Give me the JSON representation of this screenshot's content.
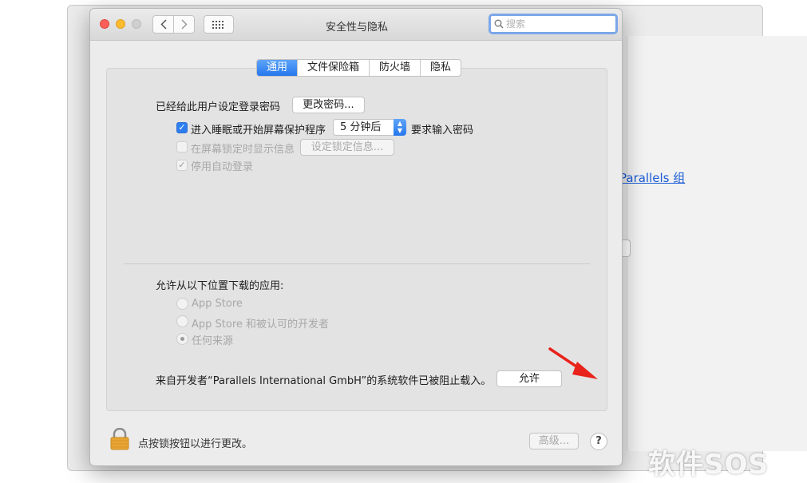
{
  "background_window": {
    "link_text": "Parallels 组"
  },
  "window": {
    "title": "安全性与隐私",
    "search_placeholder": "搜索"
  },
  "tabs": [
    {
      "label": "通用",
      "active": true
    },
    {
      "label": "文件保险箱",
      "active": false
    },
    {
      "label": "防火墙",
      "active": false
    },
    {
      "label": "隐私",
      "active": false
    }
  ],
  "general": {
    "password_set_label": "已经给此用户设定登录密码",
    "change_password_button": "更改密码...",
    "require_password": {
      "checked": true,
      "label": "进入睡眠或开始屏幕保护程序",
      "delay_value": "5 分钟后",
      "suffix": "要求输入密码"
    },
    "show_message": {
      "checked": false,
      "enabled": false,
      "label": "在屏幕锁定时显示信息",
      "button": "设定锁定信息..."
    },
    "disable_auto_login": {
      "checked": true,
      "enabled": false,
      "label": "停用自动登录"
    }
  },
  "downloads": {
    "heading": "允许从以下位置下载的应用:",
    "options": [
      {
        "label": "App Store",
        "selected": false
      },
      {
        "label": "App Store 和被认可的开发者",
        "selected": false
      },
      {
        "label": "任何来源",
        "selected": true
      }
    ]
  },
  "blocked": {
    "message": "来自开发者“Parallels International GmbH”的系统软件已被阻止载入。",
    "allow_button": "允许"
  },
  "footer": {
    "lock_text": "点按锁按钮以进行更改。",
    "advanced_button": "高级...",
    "help_button": "?"
  },
  "watermark": "软件SOS",
  "colors": {
    "accent": "#2677ee",
    "annotation_arrow": "#e8231b"
  }
}
